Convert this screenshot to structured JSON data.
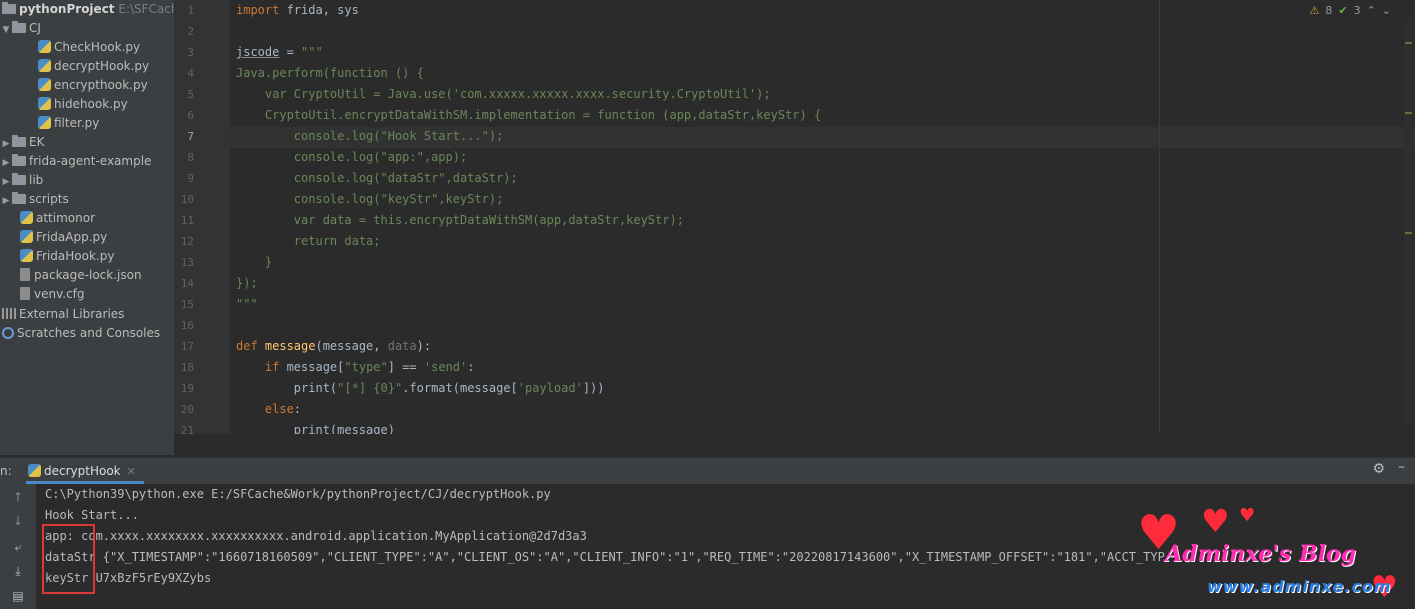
{
  "project": {
    "root_name": "pythonProject",
    "root_path": "E:\\SFCache&",
    "items": [
      {
        "label": "CJ",
        "kind": "folder",
        "expanded": true
      },
      {
        "label": "CheckHook.py",
        "kind": "py"
      },
      {
        "label": "decryptHook.py",
        "kind": "py"
      },
      {
        "label": "encrypthook.py",
        "kind": "py"
      },
      {
        "label": "hidehook.py",
        "kind": "py"
      },
      {
        "label": "filter.py",
        "kind": "py"
      },
      {
        "label": "EK",
        "kind": "folder",
        "expanded": false
      },
      {
        "label": "frida-agent-example",
        "kind": "folder",
        "expanded": false
      },
      {
        "label": "lib",
        "kind": "folder",
        "expanded": false
      },
      {
        "label": "scripts",
        "kind": "folder",
        "expanded": false
      },
      {
        "label": "attimonor",
        "kind": "py"
      },
      {
        "label": "FridaApp.py",
        "kind": "py"
      },
      {
        "label": "FridaHook.py",
        "kind": "py"
      },
      {
        "label": "package-lock.json",
        "kind": "json"
      },
      {
        "label": "venv.cfg",
        "kind": "cfg"
      },
      {
        "label": "External Libraries",
        "kind": "lib"
      },
      {
        "label": "Scratches and Consoles",
        "kind": "scratch"
      }
    ]
  },
  "editor": {
    "inspections": {
      "warnings": "8",
      "ok": "3"
    },
    "line_numbers": [
      "1",
      "2",
      "3",
      "4",
      "5",
      "6",
      "7",
      "8",
      "9",
      "10",
      "11",
      "12",
      "13",
      "14",
      "15",
      "16",
      "17",
      "18",
      "19",
      "20",
      "21"
    ],
    "code": {
      "l1_import": "import",
      "l1_rest": " frida, sys",
      "l3_var": "jscode",
      "l3_eq": " = ",
      "l3_str": "\"\"\"",
      "l4": "Java.perform(function () {",
      "l5": "    var CryptoUtil = Java.use('com.xxxxx.xxxxx.xxxx.security.CryptoUtil');",
      "l6": "    CryptoUtil.encryptDataWithSM.implementation = function (app,dataStr,keyStr) {",
      "l7": "        console.log(\"Hook Start...\");",
      "l8": "        console.log(\"app:\",app);",
      "l9": "        console.log(\"dataStr\",dataStr);",
      "l10": "        console.log(\"keyStr\",keyStr);",
      "l11": "        var data = this.encryptDataWithSM(app,dataStr,keyStr);",
      "l12": "        return data;",
      "l13": "    }",
      "l14": "});",
      "l15": "\"\"\"",
      "l17_def": "def",
      "l17_name": " message",
      "l17_open": "(message, ",
      "l17_param": "data",
      "l17_close": "):",
      "l18_if": "    if",
      "l18_mid": " message[",
      "l18_s1": "\"type\"",
      "l18_eq": "] == ",
      "l18_s2": "'send'",
      "l18_end": ":",
      "l19_a": "        print(",
      "l19_s1": "\"[*] {0}\"",
      "l19_b": ".format(message[",
      "l19_s2": "'payload'",
      "l19_c": "]))",
      "l20_else": "    else",
      "l20_end": ":",
      "l21": "        print(message)"
    }
  },
  "run": {
    "label": "n:",
    "tab": "decryptHook",
    "console": [
      "C:\\Python39\\python.exe E:/SFCache&Work/pythonProject/CJ/decryptHook.py",
      "Hook Start...",
      "app: com.xxxx.xxxxxxxx.xxxxxxxxxx.android.application.MyApplication@2d7d3a3",
      "dataStr {\"X_TIMESTAMP\":\"1660718160509\",\"CLIENT_TYPE\":\"A\",\"CLIENT_OS\":\"A\",\"CLIENT_INFO\":\"1\",\"REQ_TIME\":\"20220817143600\",\"X_TIMESTAMP_OFFSET\":\"181\",\"ACCT_TYP",
      "keyStr U7xBzF5rEy9XZybs"
    ]
  },
  "watermark": {
    "title": "Adminxe's Blog",
    "url": "www.adminxe.com"
  }
}
